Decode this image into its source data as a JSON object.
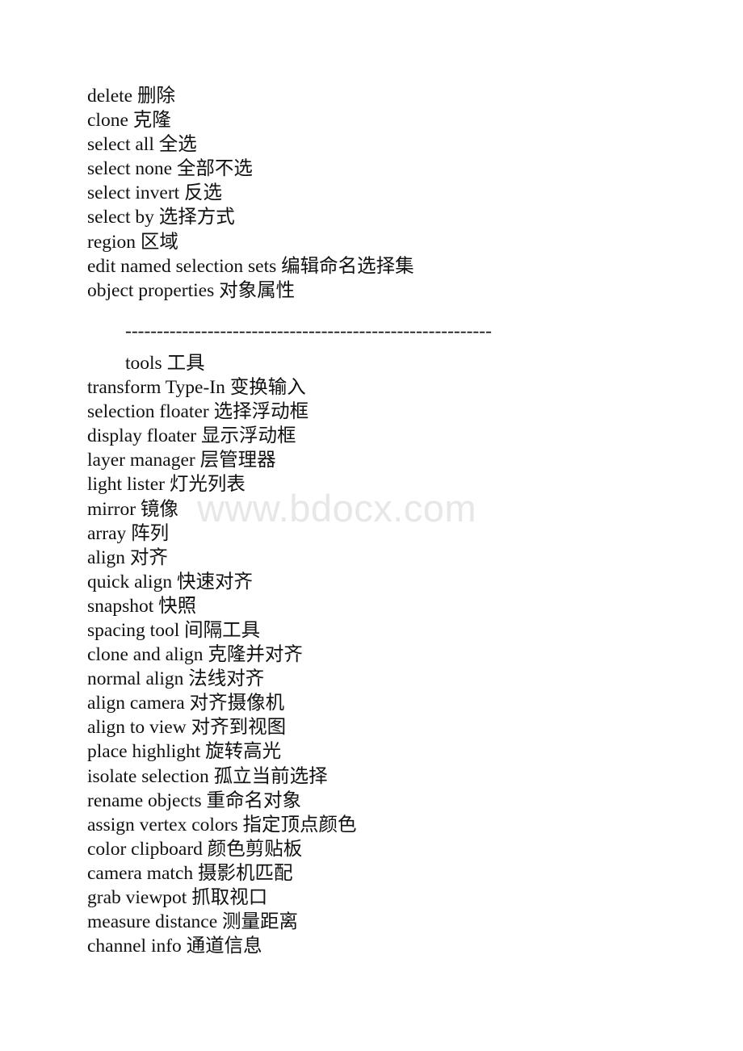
{
  "document": {
    "background_color": "#ffffff",
    "text_color": "#111111",
    "watermark": {
      "text": "www.bdocx.com",
      "color": "#e7e7e7"
    },
    "divider": {
      "text": "----------------------------------------------------------"
    },
    "section_heading": {
      "text": "tools 工具"
    },
    "section_one_lines": [
      {
        "text": "delete 删除"
      },
      {
        "text": "clone 克隆"
      },
      {
        "text": "select all 全选"
      },
      {
        "text": "select none 全部不选"
      },
      {
        "text": "select invert 反选"
      },
      {
        "text": "select by 选择方式"
      },
      {
        "text": "region 区域"
      },
      {
        "text": "edit named selection sets 编辑命名选择集"
      },
      {
        "text": "object properties 对象属性"
      }
    ],
    "section_two_lines": [
      {
        "text": "transform Type-In 变换输入"
      },
      {
        "text": "selection floater 选择浮动框"
      },
      {
        "text": "display floater 显示浮动框"
      },
      {
        "text": "layer manager 层管理器"
      },
      {
        "text": "light lister 灯光列表"
      },
      {
        "text": "mirror 镜像"
      },
      {
        "text": "array 阵列"
      },
      {
        "text": "align 对齐"
      },
      {
        "text": "quick align 快速对齐"
      },
      {
        "text": "snapshot 快照"
      },
      {
        "text": "spacing tool 间隔工具"
      },
      {
        "text": "clone and align 克隆并对齐"
      },
      {
        "text": "normal align 法线对齐"
      },
      {
        "text": "align camera 对齐摄像机"
      },
      {
        "text": "align to view 对齐到视图"
      },
      {
        "text": "place highlight 旋转高光"
      },
      {
        "text": "isolate selection 孤立当前选择"
      },
      {
        "text": "rename objects 重命名对象"
      },
      {
        "text": "assign vertex colors 指定顶点颜色"
      },
      {
        "text": "color clipboard 颜色剪贴板"
      },
      {
        "text": "camera match 摄影机匹配"
      },
      {
        "text": "grab viewpot 抓取视口"
      },
      {
        "text": "measure distance 测量距离"
      },
      {
        "text": "channel info 通道信息"
      }
    ]
  }
}
